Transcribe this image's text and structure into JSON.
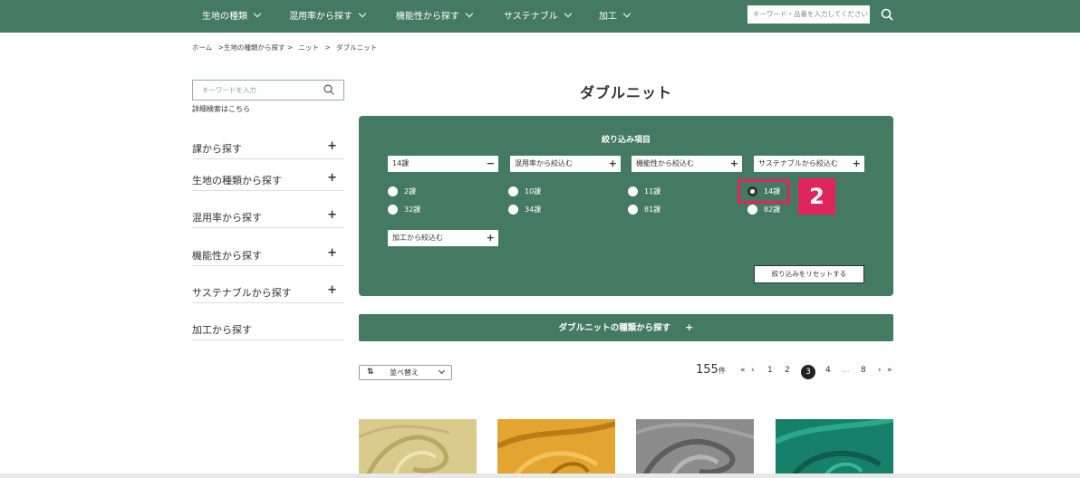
{
  "nav": {
    "items": [
      "生地の種類",
      "混用率から探す",
      "機能性から探す",
      "サステナブル",
      "加工"
    ],
    "search_placeholder": "キーワード・品番を入力してください"
  },
  "breadcrumb": [
    "ホーム",
    ">生地の種類から探す >",
    "ニット",
    ">",
    "ダブルニット"
  ],
  "sidebar": {
    "search_placeholder": "キーワードを入力",
    "advanced_link": "詳細検索はこちら",
    "items": [
      "課から探す",
      "生地の種類から探す",
      "混用率から探す",
      "機能性から探す",
      "サステナブルから探す",
      "加工から探す"
    ]
  },
  "page_title": "ダブルニット",
  "filter": {
    "title": "絞り込み項目",
    "dropdowns": [
      "14課",
      "混用率から絞込む",
      "機能性から絞込む",
      "サステナブルから絞込む",
      "加工から絞込む"
    ],
    "options": [
      "2課",
      "10課",
      "11課",
      "14課",
      "32課",
      "34課",
      "81課",
      "82課"
    ],
    "selected": "14課",
    "badge": "2",
    "reset": "絞り込みをリセットする"
  },
  "type_bar": {
    "label": "ダブルニットの種類から探す",
    "sign": "+"
  },
  "sort": {
    "label": "並べ替え",
    "icon": "sort-icon"
  },
  "results": {
    "count": "155",
    "unit": "件"
  },
  "pagination": {
    "first": "«",
    "prev": "‹",
    "pages": [
      "1",
      "2",
      "3",
      "4",
      "...",
      "8"
    ],
    "current": "3",
    "next": "›",
    "last": "»"
  },
  "colors": {
    "brand": "#447a62",
    "highlight": "#e0245e"
  }
}
